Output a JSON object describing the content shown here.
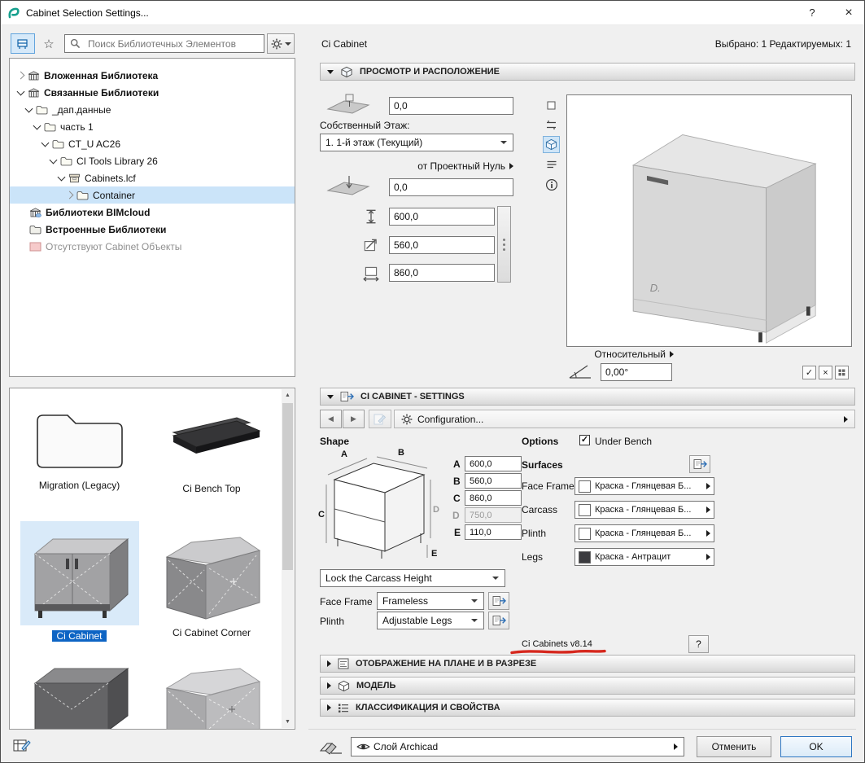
{
  "window": {
    "title": "Cabinet Selection Settings..."
  },
  "icons": {
    "star": "☆",
    "help": "?",
    "cross": "×",
    "prev": "◀",
    "next": "▶",
    "check": "✓",
    "scroll_up": "▲",
    "scroll_down": "▼"
  },
  "library_panel": {
    "search_placeholder": "Поиск Библиотечных Элементов",
    "tree": [
      {
        "label": "Вложенная Библиотека"
      },
      {
        "label": "Связанные Библиотеки"
      },
      {
        "label": "_дап.данные"
      },
      {
        "label": "часть 1"
      },
      {
        "label": "CT_U AC26"
      },
      {
        "label": "CI Tools Library 26"
      },
      {
        "label": "Cabinets.lcf"
      },
      {
        "label": "Container"
      },
      {
        "label": "Библиотеки BIMcloud"
      },
      {
        "label": "Встроенные Библиотеки"
      },
      {
        "label": "Отсутствуют Cabinet Объекты"
      }
    ],
    "thumbnails": [
      {
        "label": "Migration (Legacy)"
      },
      {
        "label": "Ci Bench Top"
      },
      {
        "label": "Ci Cabinet"
      },
      {
        "label": "Ci Cabinet Corner"
      }
    ]
  },
  "header": {
    "object_name": "Ci Cabinet",
    "selection_info": "Выбрано: 1 Редактируемых: 1"
  },
  "sections": {
    "preview": "ПРОСМОТР И РАСПОЛОЖЕНИЕ",
    "settings": "CI CABINET - SETTINGS",
    "plan": "ОТОБРАЖЕНИЕ НА ПЛАНЕ И В РАЗРЕЗЕ",
    "model": "МОДЕЛЬ",
    "classification": "КЛАССИФИКАЦИЯ И СВОЙСТВА"
  },
  "preview": {
    "elevation_top": "0,0",
    "story_label": "Собственный Этаж:",
    "story_value": "1. 1-й этаж (Текущий)",
    "reference_label": "от Проектный Нуль",
    "elevation_ref": "0,0",
    "dim_height": "600,0",
    "dim_depth": "560,0",
    "dim_width": "860,0",
    "relative_label": "Относительный",
    "angle_value": "0,00°",
    "watermark": "D."
  },
  "settings": {
    "configuration_label": "Configuration...",
    "shape_label": "Shape",
    "dims": [
      {
        "label": "A",
        "value": "600,0"
      },
      {
        "label": "B",
        "value": "560,0"
      },
      {
        "label": "C",
        "value": "860,0"
      },
      {
        "label": "D",
        "value": "750,0"
      },
      {
        "label": "E",
        "value": "110,0"
      }
    ],
    "lock_value": "Lock the Carcass Height",
    "face_frame_label": "Face Frame",
    "face_frame_value": "Frameless",
    "plinth_label": "Plinth",
    "plinth_value": "Adjustable Legs",
    "options_label": "Options",
    "under_bench_label": "Under Bench",
    "surfaces_label": "Surfaces",
    "materials": [
      {
        "label": "Face Frame",
        "value": "Краска - Глянцевая Б...",
        "swatch": "#ffffff"
      },
      {
        "label": "Carcass",
        "value": "Краска - Глянцевая Б...",
        "swatch": "#ffffff"
      },
      {
        "label": "Plinth",
        "value": "Краска - Глянцевая Б...",
        "swatch": "#ffffff"
      },
      {
        "label": "Legs",
        "value": "Краска - Антрацит",
        "swatch": "#3b3b3f"
      }
    ],
    "version": "Ci Cabinets v8.14"
  },
  "footer": {
    "layer_value": "Слой Archicad",
    "cancel_label": "Отменить",
    "ok_label": "OK"
  },
  "colors": {
    "selection_blue": "#0d64c4",
    "tree_selection": "#cbe4f9",
    "annotation_red": "#d6281e",
    "accent": "#2f77c2"
  }
}
